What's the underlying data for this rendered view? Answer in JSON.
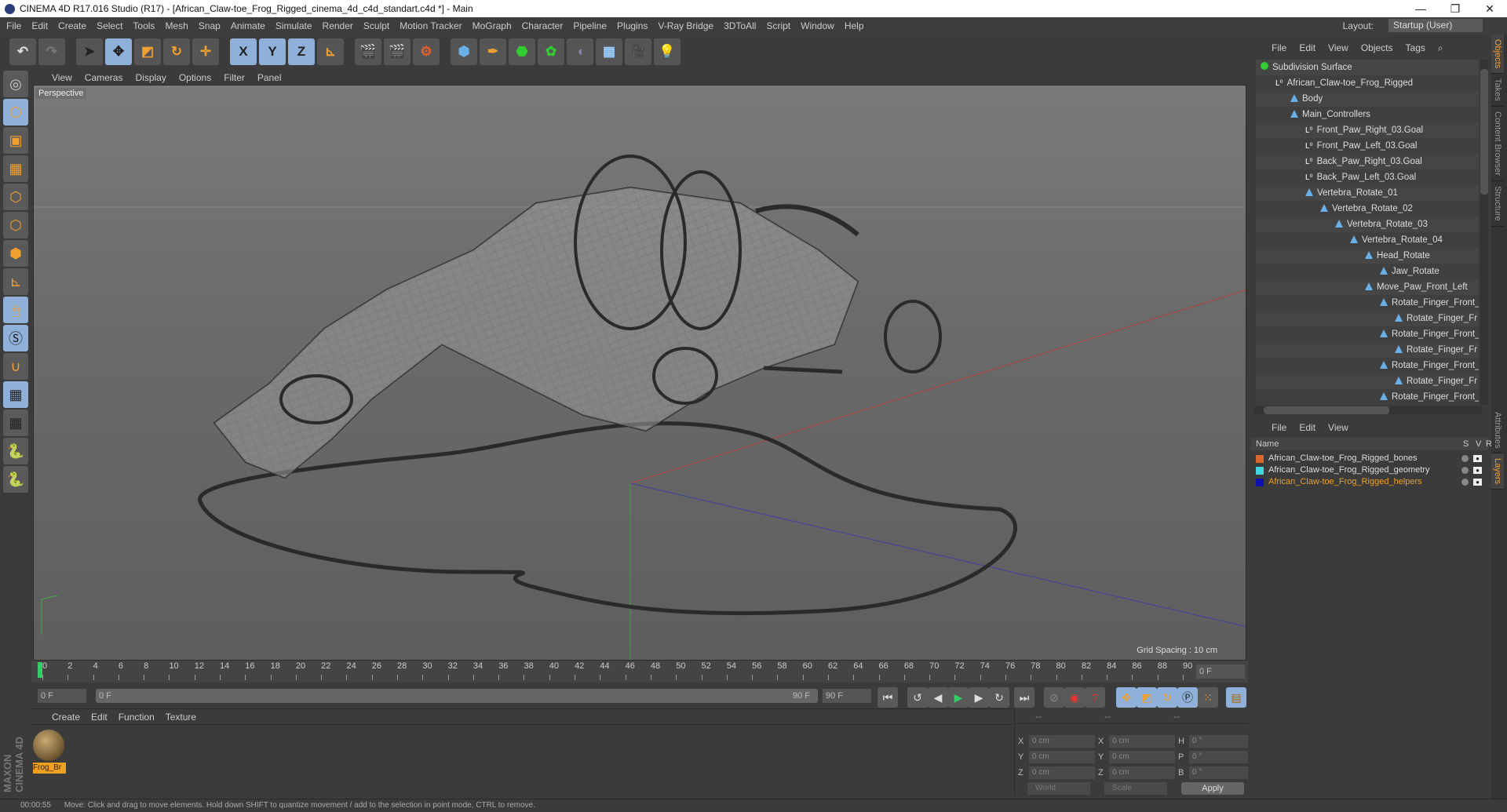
{
  "title": "CINEMA 4D R17.016 Studio (R17) - [African_Claw-toe_Frog_Rigged_cinema_4d_c4d_standart.c4d *] - Main",
  "menu": [
    "File",
    "Edit",
    "Create",
    "Select",
    "Tools",
    "Mesh",
    "Snap",
    "Animate",
    "Simulate",
    "Render",
    "Sculpt",
    "Motion Tracker",
    "MoGraph",
    "Character",
    "Pipeline",
    "Plugins",
    "V-Ray Bridge",
    "3DToAll",
    "Script",
    "Window",
    "Help"
  ],
  "layout": {
    "label": "Layout:",
    "value": "Startup (User)"
  },
  "toolbar": {
    "x": "X",
    "y": "Y",
    "z": "Z"
  },
  "viewport": {
    "menu": [
      "View",
      "Cameras",
      "Display",
      "Options",
      "Filter",
      "Panel"
    ],
    "label": "Perspective",
    "grid_spacing": "Grid Spacing : 10 cm"
  },
  "timeline": {
    "ticks": [
      0,
      2,
      4,
      6,
      8,
      10,
      12,
      14,
      16,
      18,
      20,
      22,
      24,
      26,
      28,
      30,
      32,
      34,
      36,
      38,
      40,
      42,
      44,
      46,
      48,
      50,
      52,
      54,
      56,
      58,
      60,
      62,
      64,
      66,
      68,
      70,
      72,
      74,
      76,
      78,
      80,
      82,
      84,
      86,
      88,
      90
    ],
    "current": "0 F",
    "start": "0 F",
    "range_start": "0 F",
    "range_end": "90 F",
    "end": "90 F"
  },
  "material": {
    "menu": [
      "Create",
      "Edit",
      "Function",
      "Texture"
    ],
    "item": "Frog_Br"
  },
  "coords": {
    "header": [
      "--",
      "--",
      "--"
    ],
    "rows": [
      {
        "a": "X",
        "av": "0 cm",
        "b": "X",
        "bv": "0 cm",
        "c": "H",
        "cv": "0 °"
      },
      {
        "a": "Y",
        "av": "0 cm",
        "b": "Y",
        "bv": "0 cm",
        "c": "P",
        "cv": "0 °"
      },
      {
        "a": "Z",
        "av": "0 cm",
        "b": "Z",
        "bv": "0 cm",
        "c": "B",
        "cv": "0 °"
      }
    ],
    "world": "World",
    "scale": "Scale",
    "apply": "Apply"
  },
  "objects": {
    "menu": [
      "File",
      "Edit",
      "View",
      "Objects",
      "Tags"
    ],
    "items": [
      {
        "name": "Subdivision Surface",
        "depth": 0,
        "icon": "subdiv"
      },
      {
        "name": "African_Claw-toe_Frog_Rigged",
        "depth": 1,
        "icon": "null"
      },
      {
        "name": "Body",
        "depth": 2,
        "icon": "joint"
      },
      {
        "name": "Main_Controllers",
        "depth": 2,
        "icon": "joint"
      },
      {
        "name": "Front_Paw_Right_03.Goal",
        "depth": 3,
        "icon": "null"
      },
      {
        "name": "Front_Paw_Left_03.Goal",
        "depth": 3,
        "icon": "null"
      },
      {
        "name": "Back_Paw_Right_03.Goal",
        "depth": 3,
        "icon": "null"
      },
      {
        "name": "Back_Paw_Left_03.Goal",
        "depth": 3,
        "icon": "null"
      },
      {
        "name": "Vertebra_Rotate_01",
        "depth": 3,
        "icon": "joint"
      },
      {
        "name": "Vertebra_Rotate_02",
        "depth": 4,
        "icon": "joint"
      },
      {
        "name": "Vertebra_Rotate_03",
        "depth": 5,
        "icon": "joint"
      },
      {
        "name": "Vertebra_Rotate_04",
        "depth": 6,
        "icon": "joint"
      },
      {
        "name": "Head_Rotate",
        "depth": 7,
        "icon": "joint"
      },
      {
        "name": "Jaw_Rotate",
        "depth": 8,
        "icon": "joint"
      },
      {
        "name": "Move_Paw_Front_Left",
        "depth": 7,
        "icon": "joint"
      },
      {
        "name": "Rotate_Finger_Front_",
        "depth": 8,
        "icon": "joint"
      },
      {
        "name": "Rotate_Finger_Fr",
        "depth": 9,
        "icon": "joint"
      },
      {
        "name": "Rotate_Finger_Front_",
        "depth": 8,
        "icon": "joint"
      },
      {
        "name": "Rotate_Finger_Fr",
        "depth": 9,
        "icon": "joint"
      },
      {
        "name": "Rotate_Finger_Front_",
        "depth": 8,
        "icon": "joint"
      },
      {
        "name": "Rotate_Finger_Fr",
        "depth": 9,
        "icon": "joint"
      },
      {
        "name": "Rotate_Finger_Front_",
        "depth": 8,
        "icon": "joint"
      }
    ]
  },
  "layers": {
    "menu": [
      "File",
      "Edit",
      "View"
    ],
    "columns": [
      "Name",
      "S",
      "V",
      "R"
    ],
    "items": [
      {
        "name": "African_Claw-toe_Frog_Rigged_bones",
        "color": "#d9692a",
        "text_color": "#dddddd"
      },
      {
        "name": "African_Claw-toe_Frog_Rigged_geometry",
        "color": "#3fd8e0",
        "text_color": "#dddddd"
      },
      {
        "name": "African_Claw-toe_Frog_Rigged_helpers",
        "color": "#1010b0",
        "text_color": "#f0a020"
      }
    ]
  },
  "side_tabs": [
    "Objects",
    "Takes",
    "Content Browser",
    "Structure",
    "Attributes",
    "Layers"
  ],
  "status": {
    "time": "00:00:55",
    "message": "Move: Click and drag to move elements. Hold down SHIFT to quantize movement / add to the selection in point mode, CTRL to remove."
  },
  "brand": "MAXON CINEMA 4D"
}
